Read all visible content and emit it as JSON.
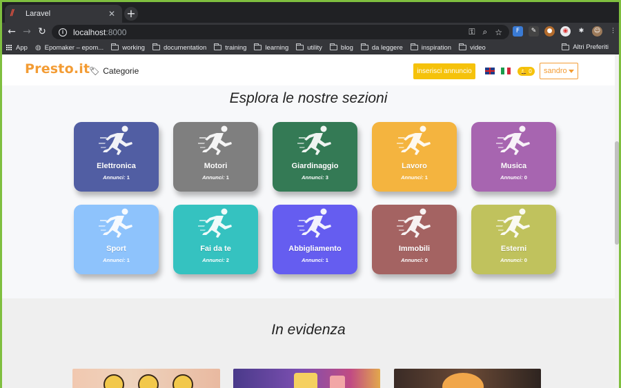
{
  "browser": {
    "tab_title": "Laravel",
    "url_host": "localhost",
    "url_port": ":8000",
    "bookmarks": [
      {
        "label": "App",
        "icon": "apps-grid-icon"
      },
      {
        "label": "Epomaker – epom...",
        "icon": "globe-icon"
      },
      {
        "label": "working",
        "icon": "folder-icon"
      },
      {
        "label": "documentation",
        "icon": "folder-icon"
      },
      {
        "label": "training",
        "icon": "folder-icon"
      },
      {
        "label": "learning",
        "icon": "folder-icon"
      },
      {
        "label": "utility",
        "icon": "folder-icon"
      },
      {
        "label": "blog",
        "icon": "folder-icon"
      },
      {
        "label": "da leggere",
        "icon": "folder-icon"
      },
      {
        "label": "inspiration",
        "icon": "folder-icon"
      },
      {
        "label": "video",
        "icon": "folder-icon"
      }
    ],
    "other_bookmarks": "Altri Preferiti"
  },
  "site": {
    "logo": "Presto.it",
    "categories_link": "Categorie",
    "insert_button": "inserisci annuncio",
    "notification_count": "0",
    "user_name": "sandro"
  },
  "sections": {
    "explore_title": "Esplora le nostre sezioni",
    "featured_title": "In evidenza"
  },
  "category_count_label": "Annunci:",
  "categories": [
    {
      "name": "Elettronica",
      "count": "1",
      "color": "#515ea3"
    },
    {
      "name": "Motori",
      "count": "1",
      "color": "#7f7f7f"
    },
    {
      "name": "Giardinaggio",
      "count": "3",
      "color": "#347a55"
    },
    {
      "name": "Lavoro",
      "count": "1",
      "color": "#f4b43f"
    },
    {
      "name": "Musica",
      "count": "0",
      "color": "#a765b0"
    },
    {
      "name": "Sport",
      "count": "1",
      "color": "#8ec3fc"
    },
    {
      "name": "Fai da te",
      "count": "2",
      "color": "#35c2c0"
    },
    {
      "name": "Abbigliamento",
      "count": "1",
      "color": "#655df0"
    },
    {
      "name": "Immobili",
      "count": "0",
      "color": "#a46362"
    },
    {
      "name": "Esterni",
      "count": "0",
      "color": "#c0c25d"
    }
  ],
  "colors": {
    "accent_orange": "#f39c34",
    "accent_yellow": "#f5c20b"
  }
}
